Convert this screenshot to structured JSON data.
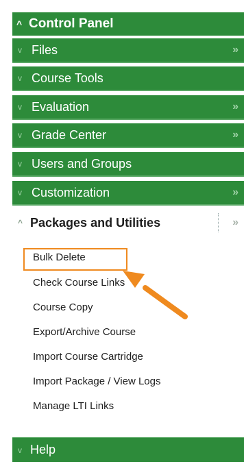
{
  "header": {
    "title": "Control Panel",
    "chevron": "^"
  },
  "menu": {
    "items": [
      {
        "label": "Files",
        "has_arrow": true
      },
      {
        "label": "Course Tools",
        "has_arrow": false
      },
      {
        "label": "Evaluation",
        "has_arrow": true
      },
      {
        "label": "Grade Center",
        "has_arrow": true
      },
      {
        "label": "Users and Groups",
        "has_arrow": false
      },
      {
        "label": "Customization",
        "has_arrow": true
      }
    ],
    "expanded": {
      "label": "Packages and Utilities",
      "subitems": [
        "Bulk Delete",
        "Check Course Links",
        "Course Copy",
        "Export/Archive Course",
        "Import Course Cartridge",
        "Import Package / View Logs",
        "Manage LTI Links"
      ]
    },
    "footer": {
      "label": "Help"
    }
  },
  "icons": {
    "expand": "chevron-down-icon",
    "collapse": "chevron-up-icon",
    "submenu": "double-chevron-right-icon",
    "annotation": "orange-arrow"
  },
  "colors": {
    "menu_green": "#2d8b3a",
    "highlight_orange": "#ef8a1f"
  }
}
